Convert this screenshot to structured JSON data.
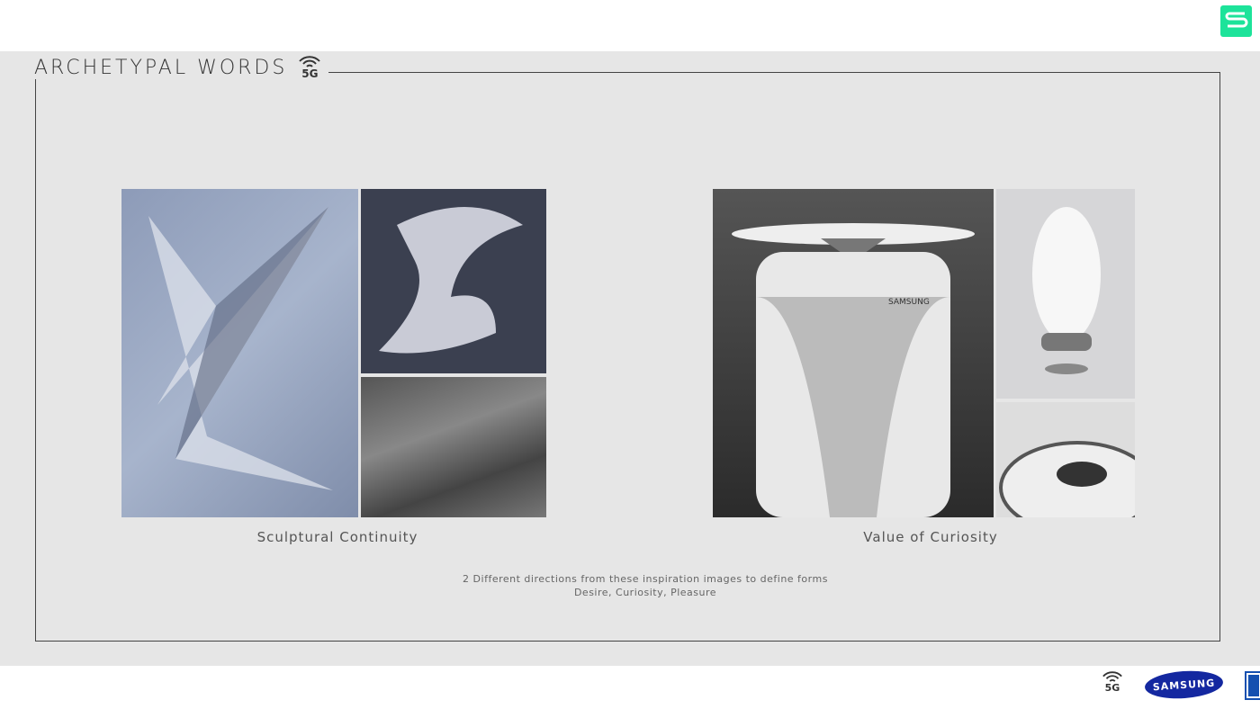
{
  "header": {
    "title": "ARCHETYPAL WORDS",
    "badge": "5G",
    "brand_color": "#1de39a"
  },
  "groups": [
    {
      "caption": "Sculptural Continuity"
    },
    {
      "caption": "Value of Curiosity",
      "product_label": "SAMSUNG"
    }
  ],
  "note": {
    "line1": "2 Different directions from these inspiration images to define forms",
    "line2": "Desire, Curiosity, Pleasure"
  },
  "footer": {
    "badge": "5G",
    "brand": "SAMSUNG",
    "brand_color": "#1428a0"
  }
}
